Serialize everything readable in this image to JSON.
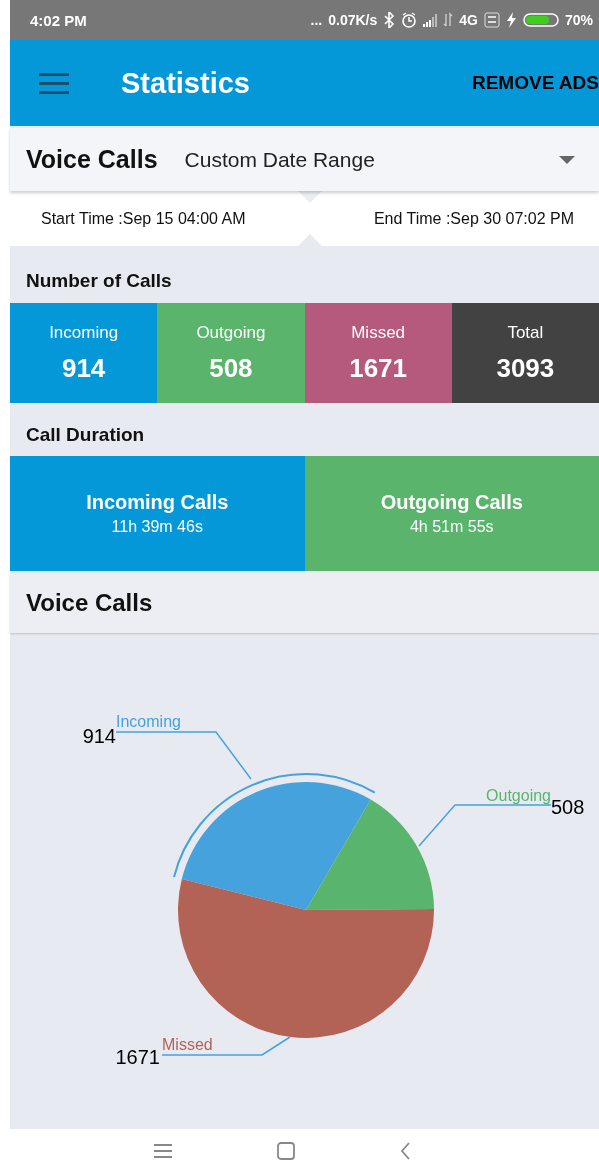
{
  "status_bar": {
    "time": "4:02 PM",
    "more": "...",
    "speed": "0.07K/s",
    "network": "4G",
    "battery": "70%"
  },
  "app_bar": {
    "title": "Statistics",
    "action": "REMOVE ADS"
  },
  "filter": {
    "title": "Voice Calls",
    "range": "Custom Date Range"
  },
  "date_range": {
    "start": "Start Time :Sep 15 04:00 AM",
    "end": "End Time :Sep 30 07:02 PM"
  },
  "number_of_calls": {
    "title": "Number of Calls",
    "tiles": [
      {
        "label": "Incoming",
        "value": "914",
        "color": "#0598d8"
      },
      {
        "label": "Outgoing",
        "value": "508",
        "color": "#5bb46c"
      },
      {
        "label": "Missed",
        "value": "1671",
        "color": "#b55a7c"
      },
      {
        "label": "Total",
        "value": "3093",
        "color": "#424242"
      }
    ]
  },
  "call_duration": {
    "title": "Call Duration",
    "tiles": [
      {
        "label": "Incoming Calls",
        "value": "11h 39m 46s",
        "color": "#0598d8"
      },
      {
        "label": "Outgoing Calls",
        "value": "4h 51m 55s",
        "color": "#5bb46c"
      }
    ]
  },
  "chart_section": {
    "title": "Voice Calls",
    "chart_data": {
      "type": "pie",
      "categories": [
        "Incoming",
        "Outgoing",
        "Missed"
      ],
      "values": [
        914,
        508,
        1671
      ],
      "colors": [
        "#46a2dc",
        "#59b46d",
        "#b36256"
      ],
      "data_labels": true
    }
  }
}
